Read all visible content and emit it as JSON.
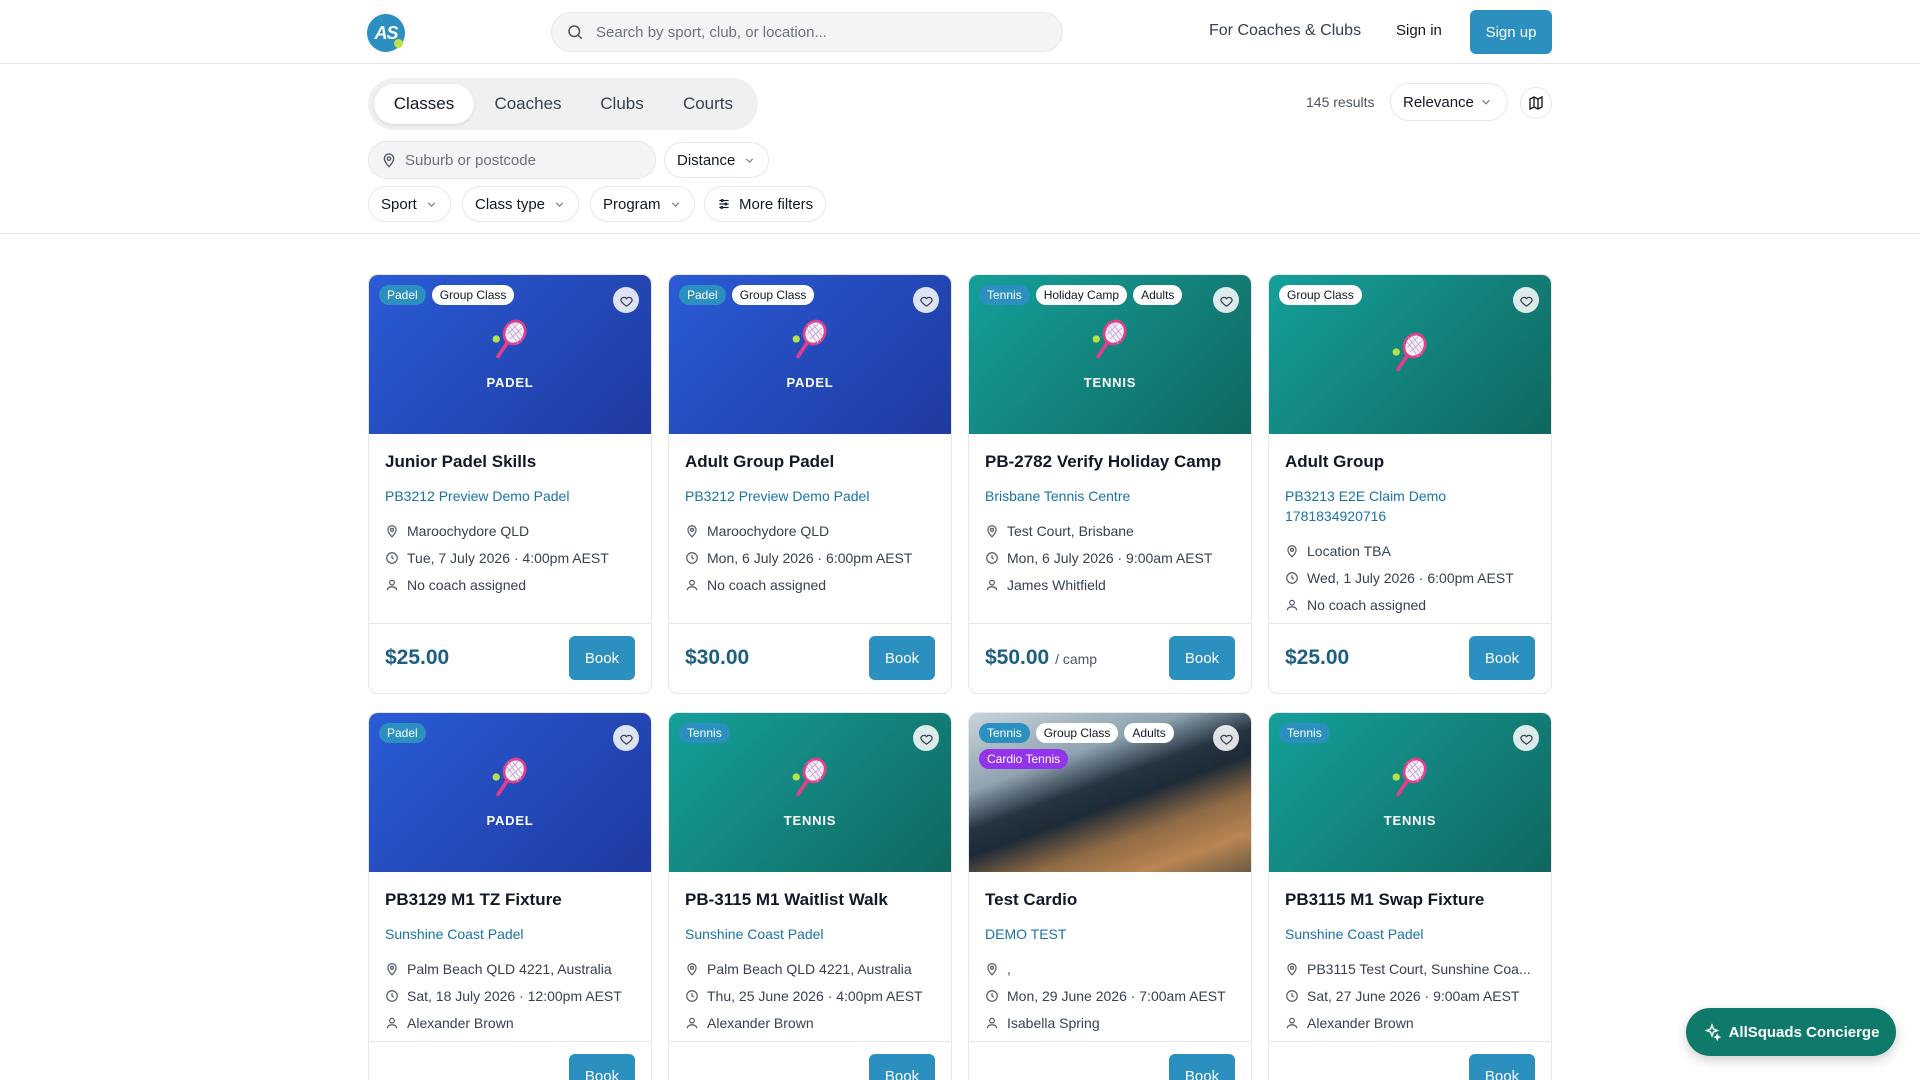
{
  "header": {
    "search_placeholder": "Search by sport, club, or location...",
    "for_coaches": "For Coaches & Clubs",
    "sign_in": "Sign in",
    "sign_up": "Sign up"
  },
  "tabs": [
    "Classes",
    "Coaches",
    "Clubs",
    "Courts"
  ],
  "results_count": "145 results",
  "sort_label": "Relevance",
  "filters": {
    "location_placeholder": "Suburb or postcode",
    "distance": "Distance",
    "sport": "Sport",
    "class_type": "Class type",
    "program": "Program",
    "more": "More filters"
  },
  "cards": [
    {
      "tags": [
        "Padel",
        "Group Class"
      ],
      "sport_label": "PADEL",
      "title": "Junior Padel Skills",
      "club": "PB3212 Preview Demo Padel",
      "location": "Maroochydore QLD",
      "datetime": "Tue, 7 July 2026 · 4:00pm AEST",
      "coach": "No coach assigned",
      "price": "$25.00",
      "unit": "",
      "book": "Book"
    },
    {
      "tags": [
        "Padel",
        "Group Class"
      ],
      "sport_label": "PADEL",
      "title": "Adult Group Padel",
      "club": "PB3212 Preview Demo Padel",
      "location": "Maroochydore QLD",
      "datetime": "Mon, 6 July 2026 · 6:00pm AEST",
      "coach": "No coach assigned",
      "price": "$30.00",
      "unit": "",
      "book": "Book"
    },
    {
      "tags": [
        "Tennis",
        "Holiday Camp",
        "Adults"
      ],
      "sport_label": "TENNIS",
      "title": "PB-2782 Verify Holiday Camp",
      "club": "Brisbane Tennis Centre",
      "location": "Test Court, Brisbane",
      "datetime": "Mon, 6 July 2026 · 9:00am AEST",
      "coach": "James Whitfield",
      "price": "$50.00",
      "unit": "/ camp",
      "book": "Book"
    },
    {
      "tags": [
        "Group Class"
      ],
      "sport_label": "",
      "title": "Adult Group",
      "club": "PB3213 E2E Claim Demo 1781834920716",
      "location": "Location TBA",
      "datetime": "Wed, 1 July 2026 · 6:00pm AEST",
      "coach": "No coach assigned",
      "price": "$25.00",
      "unit": "",
      "book": "Book"
    },
    {
      "tags": [
        "Padel"
      ],
      "sport_label": "PADEL",
      "title": "PB3129 M1 TZ Fixture",
      "club": "Sunshine Coast Padel",
      "location": "Palm Beach QLD 4221, Australia",
      "datetime": "Sat, 18 July 2026 · 12:00pm AEST",
      "coach": "Alexander Brown",
      "price": "",
      "unit": "",
      "book": "Book"
    },
    {
      "tags": [
        "Tennis"
      ],
      "sport_label": "TENNIS",
      "title": "PB-3115 M1 Waitlist Walk",
      "club": "Sunshine Coast Padel",
      "location": "Palm Beach QLD 4221, Australia",
      "datetime": "Thu, 25 June 2026 · 4:00pm AEST",
      "coach": "Alexander Brown",
      "price": "",
      "unit": "",
      "book": "Book"
    },
    {
      "tags": [
        "Tennis",
        "Group Class",
        "Adults",
        "Cardio Tennis"
      ],
      "sport_label": "",
      "title": "Test Cardio",
      "club": "DEMO TEST",
      "location": ",",
      "datetime": "Mon, 29 June 2026 · 7:00am AEST",
      "coach": "Isabella Spring",
      "price": "",
      "unit": "",
      "book": "Book"
    },
    {
      "tags": [
        "Tennis"
      ],
      "sport_label": "TENNIS",
      "title": "PB3115 M1 Swap Fixture",
      "club": "Sunshine Coast Padel",
      "location": "PB3115 Test Court, Sunshine Coa...",
      "datetime": "Sat, 27 June 2026 · 9:00am AEST",
      "coach": "Alexander Brown",
      "price": "",
      "unit": "",
      "book": "Book"
    }
  ],
  "concierge": "AllSquads Concierge",
  "colors": {
    "brand": "#2b90bf",
    "padel": "#2a5bd6",
    "tennis": "#15a09a",
    "cardio_tag": "#9333ea",
    "concierge": "#0f7a6a"
  }
}
